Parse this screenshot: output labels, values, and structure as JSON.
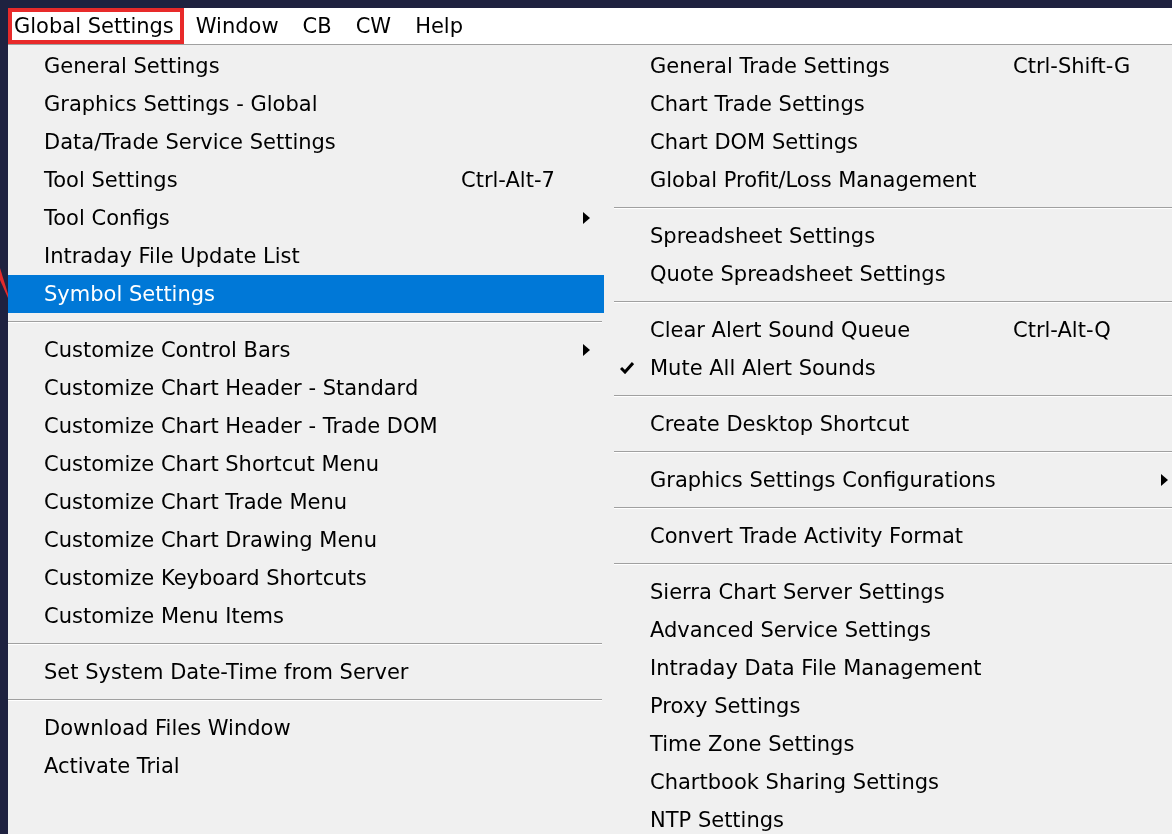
{
  "menu_bar": [
    {
      "label": "Global Settings",
      "annotated": true
    },
    {
      "label": "Window",
      "annotated": false
    },
    {
      "label": "CB",
      "annotated": false
    },
    {
      "label": "CW",
      "annotated": false
    },
    {
      "label": "Help",
      "annotated": false
    }
  ],
  "menu": {
    "columns": [
      {
        "groups": [
          [
            {
              "label": "General Settings",
              "selected": false,
              "checked": false,
              "submenu": false
            },
            {
              "label": "Graphics Settings - Global",
              "selected": false,
              "checked": false,
              "submenu": false
            },
            {
              "label": "Data/Trade Service Settings",
              "selected": false,
              "checked": false,
              "submenu": false
            },
            {
              "label": "Tool Settings",
              "shortcut": "Ctrl-Alt-7",
              "selected": false,
              "checked": false,
              "submenu": false
            },
            {
              "label": "Tool Configs",
              "selected": false,
              "checked": false,
              "submenu": true
            },
            {
              "label": "Intraday File Update List",
              "selected": false,
              "checked": false,
              "submenu": false
            },
            {
              "label": "Symbol Settings",
              "selected": true,
              "checked": false,
              "submenu": false
            }
          ],
          [
            {
              "label": "Customize Control Bars",
              "selected": false,
              "checked": false,
              "submenu": true
            },
            {
              "label": "Customize Chart Header - Standard",
              "selected": false,
              "checked": false,
              "submenu": false
            },
            {
              "label": "Customize Chart Header - Trade DOM",
              "selected": false,
              "checked": false,
              "submenu": false
            },
            {
              "label": "Customize Chart Shortcut Menu",
              "selected": false,
              "checked": false,
              "submenu": false
            },
            {
              "label": "Customize Chart Trade Menu",
              "selected": false,
              "checked": false,
              "submenu": false
            },
            {
              "label": "Customize Chart Drawing Menu",
              "selected": false,
              "checked": false,
              "submenu": false
            },
            {
              "label": "Customize Keyboard Shortcuts",
              "selected": false,
              "checked": false,
              "submenu": false
            },
            {
              "label": "Customize Menu Items",
              "selected": false,
              "checked": false,
              "submenu": false
            }
          ],
          [
            {
              "label": "Set System Date-Time from Server",
              "selected": false,
              "checked": false,
              "submenu": false
            }
          ],
          [
            {
              "label": "Download Files Window",
              "selected": false,
              "checked": false,
              "submenu": false
            },
            {
              "label": "Activate Trial",
              "selected": false,
              "checked": false,
              "submenu": false
            }
          ]
        ]
      },
      {
        "groups": [
          [
            {
              "label": "General Trade Settings",
              "shortcut": "Ctrl-Shift-G",
              "selected": false,
              "checked": false,
              "submenu": false
            },
            {
              "label": "Chart Trade Settings",
              "selected": false,
              "checked": false,
              "submenu": false
            },
            {
              "label": "Chart DOM Settings",
              "selected": false,
              "checked": false,
              "submenu": false
            },
            {
              "label": "Global Profit/Loss Management",
              "selected": false,
              "checked": false,
              "submenu": false
            }
          ],
          [
            {
              "label": "Spreadsheet Settings",
              "selected": false,
              "checked": false,
              "submenu": false
            },
            {
              "label": "Quote Spreadsheet Settings",
              "selected": false,
              "checked": false,
              "submenu": false
            }
          ],
          [
            {
              "label": "Clear Alert Sound Queue",
              "shortcut": "Ctrl-Alt-Q",
              "selected": false,
              "checked": false,
              "submenu": false
            },
            {
              "label": "Mute All Alert Sounds",
              "selected": false,
              "checked": true,
              "submenu": false
            }
          ],
          [
            {
              "label": "Create Desktop Shortcut",
              "selected": false,
              "checked": false,
              "submenu": false
            }
          ],
          [
            {
              "label": "Graphics Settings Configurations",
              "selected": false,
              "checked": false,
              "submenu": true
            }
          ],
          [
            {
              "label": "Convert Trade Activity Format",
              "selected": false,
              "checked": false,
              "submenu": false
            }
          ],
          [
            {
              "label": "Sierra Chart Server Settings",
              "selected": false,
              "checked": false,
              "submenu": false
            },
            {
              "label": "Advanced Service Settings",
              "selected": false,
              "checked": false,
              "submenu": false
            },
            {
              "label": "Intraday Data File Management",
              "selected": false,
              "checked": false,
              "submenu": false
            },
            {
              "label": "Proxy Settings",
              "selected": false,
              "checked": false,
              "submenu": false
            },
            {
              "label": "Time Zone Settings",
              "selected": false,
              "checked": false,
              "submenu": false
            },
            {
              "label": "Chartbook Sharing Settings",
              "selected": false,
              "checked": false,
              "submenu": false
            },
            {
              "label": "NTP Settings",
              "selected": false,
              "checked": false,
              "submenu": false
            }
          ]
        ]
      }
    ]
  }
}
